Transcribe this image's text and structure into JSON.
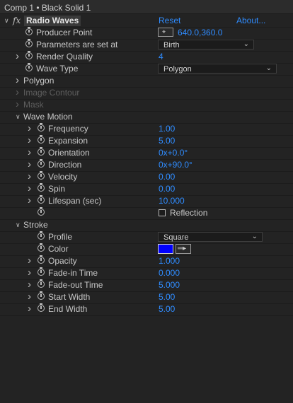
{
  "title": "Comp 1 • Black Solid 1",
  "effect": {
    "fx": "fx",
    "name": "Radio Waves",
    "reset": "Reset",
    "about": "About..."
  },
  "props": {
    "producer_point": {
      "label": "Producer Point",
      "value": "640.0,360.0"
    },
    "params_set_at": {
      "label": "Parameters are set at",
      "value": "Birth"
    },
    "render_quality": {
      "label": "Render Quality",
      "value": "4"
    },
    "wave_type": {
      "label": "Wave Type",
      "value": "Polygon"
    }
  },
  "groups": {
    "polygon": "Polygon",
    "image_contour": "Image Contour",
    "mask": "Mask",
    "wave_motion": "Wave Motion",
    "stroke": "Stroke"
  },
  "wave_motion": {
    "frequency": {
      "label": "Frequency",
      "value": "1.00"
    },
    "expansion": {
      "label": "Expansion",
      "value": "5.00"
    },
    "orientation": {
      "label": "Orientation",
      "value": "0x+0.0°"
    },
    "direction": {
      "label": "Direction",
      "value": "0x+90.0°"
    },
    "velocity": {
      "label": "Velocity",
      "value": "0.00"
    },
    "spin": {
      "label": "Spin",
      "value": "0.00"
    },
    "lifespan": {
      "label": "Lifespan (sec)",
      "value": "10.000"
    },
    "reflection": {
      "label": "Reflection",
      "checked": false
    }
  },
  "stroke": {
    "profile": {
      "label": "Profile",
      "value": "Square"
    },
    "color": {
      "label": "Color",
      "swatch": "#0000ff"
    },
    "opacity": {
      "label": "Opacity",
      "value": "1.000"
    },
    "fade_in": {
      "label": "Fade-in Time",
      "value": "0.000"
    },
    "fade_out": {
      "label": "Fade-out Time",
      "value": "5.000"
    },
    "start_width": {
      "label": "Start Width",
      "value": "5.00"
    },
    "end_width": {
      "label": "End Width",
      "value": "5.00"
    }
  },
  "colors": {
    "value_blue": "#2f8cff",
    "panel_bg": "#232323"
  },
  "icons": {
    "stopwatch": "stopwatch-icon",
    "crosshair": "crosshair-icon",
    "eyedropper": "eyedropper-icon",
    "chevron": "chevron-down-icon"
  }
}
